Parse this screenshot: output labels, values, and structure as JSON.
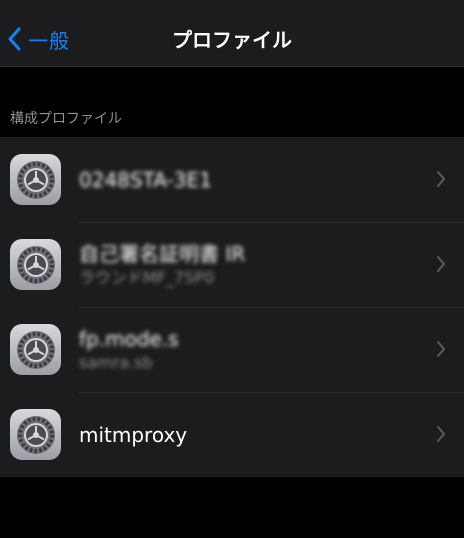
{
  "nav": {
    "back_label": "一般",
    "title": "プロファイル"
  },
  "section": {
    "header": "構成プロファイル"
  },
  "profiles": [
    {
      "title": "0248STA-3E1",
      "subtitle": "",
      "redacted": true
    },
    {
      "title": "自己署名証明書 IR",
      "subtitle": "ラウンドMF_7SP0",
      "redacted": true
    },
    {
      "title": "fp.mode.s",
      "subtitle": "samra.sb",
      "redacted": true
    },
    {
      "title": "mitmproxy",
      "subtitle": "",
      "redacted": false
    }
  ],
  "colors": {
    "accent": "#0a84ff",
    "background": "#000000",
    "cell": "#1c1c1e",
    "secondary_text": "#8e8e93"
  }
}
